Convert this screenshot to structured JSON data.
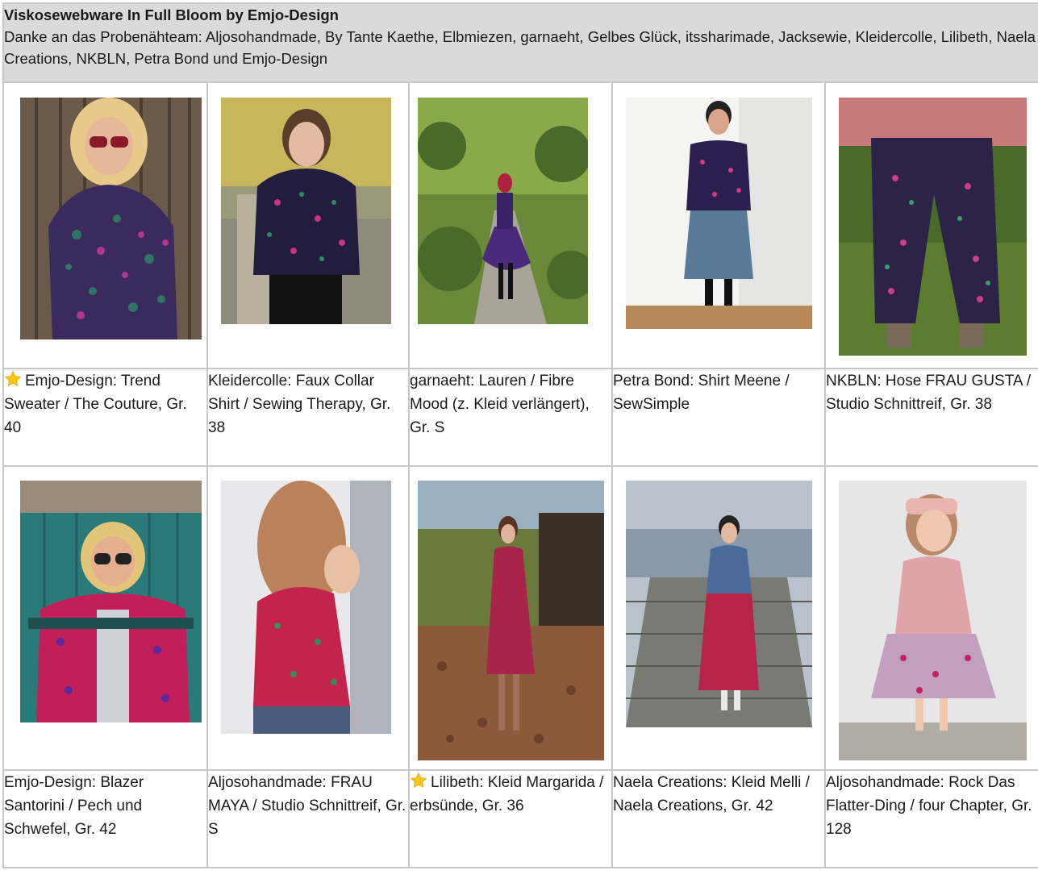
{
  "header": {
    "title": "Viskosewebware In Full Bloom by Emjo-Design",
    "thanks": "Danke an das Probenähteam: Aljosohandmade, By Tante Kaethe, Elbmiezen, garnaeht, Gelbes Glück, itssharimade, Jacksewie, Kleidercolle, Lilibeth, Naela Creations, NKBLN, Petra Bond und Emjo-Design"
  },
  "rows": [
    {
      "items": [
        {
          "caption": "Emjo-Design: Trend Sweater / The Couture, Gr. 40",
          "starred": true
        },
        {
          "caption": "Kleidercolle: Faux Collar Shirt / Sewing Therapy, Gr. 38",
          "starred": false
        },
        {
          "caption": "garnaeht: Lauren / Fibre Mood (z. Kleid verlängert), Gr. S",
          "starred": false
        },
        {
          "caption": "Petra Bond: Shirt Meene / SewSimple",
          "starred": false
        },
        {
          "caption": "NKBLN: Hose FRAU GUSTA / Studio Schnittreif, Gr. 38",
          "starred": false
        }
      ]
    },
    {
      "items": [
        {
          "caption": "Emjo-Design: Blazer Santorini / Pech und Schwefel, Gr. 42",
          "starred": false
        },
        {
          "caption": "Aljosohandmade: FRAU MAYA / Studio Schnittreif, Gr. S",
          "starred": false
        },
        {
          "caption": "Lilibeth: Kleid Margarida / erbsünde, Gr. 36",
          "starred": true
        },
        {
          "caption": "Naela Creations: Kleid Melli / Naela Creations, Gr. 42",
          "starred": false
        },
        {
          "caption": "Aljosohandmade: Rock Das Flatter-Ding / four Chapter, Gr. 128",
          "starred": false
        }
      ]
    }
  ],
  "icons": {
    "star": "star-icon"
  },
  "colors": {
    "header_bg": "#dadada",
    "border": "#c8c8c8",
    "star": "#f5c518"
  }
}
